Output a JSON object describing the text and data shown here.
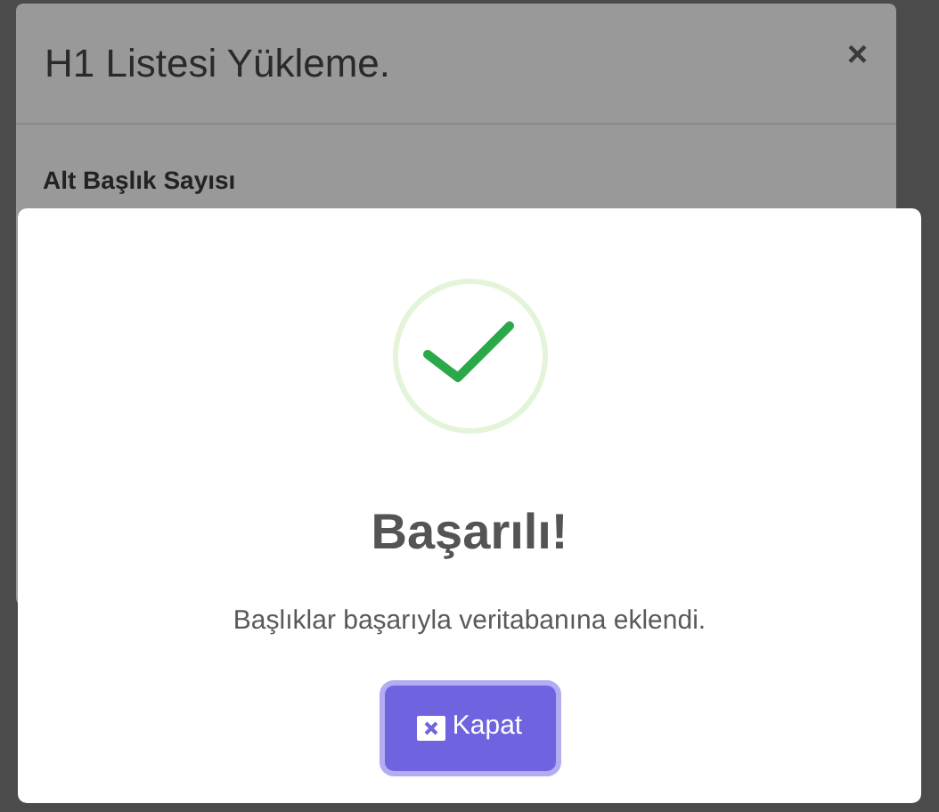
{
  "background_modal": {
    "title": "H1 Listesi Yükleme.",
    "close": "×",
    "field_label": "Alt Başlık Sayısı"
  },
  "alert": {
    "title": "Başarılı!",
    "message": "Başlıklar başarıyla veritabanına eklendi.",
    "button": {
      "label": "Kapat"
    }
  }
}
